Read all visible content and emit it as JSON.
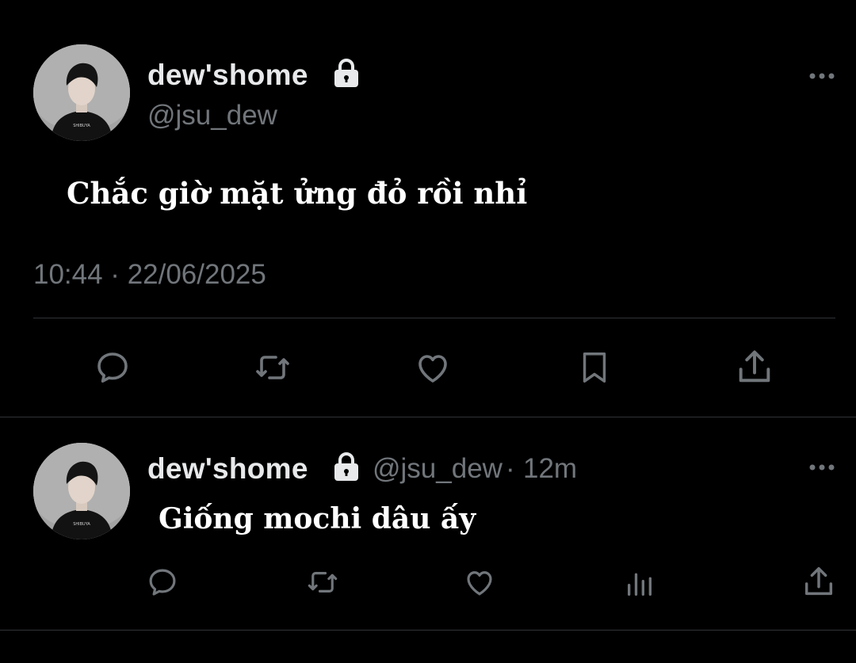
{
  "main_tweet": {
    "display_name": "dew'shome",
    "handle": "@jsu_dew",
    "text": "Chắc giờ mặt ửng đỏ rồi nhỉ",
    "timestamp": "10:44 · 22/06/2025",
    "actions": [
      "reply-icon",
      "retweet-icon",
      "like-icon",
      "bookmark-icon",
      "share-icon"
    ]
  },
  "reply": {
    "display_name": "dew'shome",
    "handle": "@jsu_dew",
    "separator": "·",
    "time": "12m",
    "text": "Giống mochi dâu ấy",
    "actions": [
      "reply-icon",
      "retweet-icon",
      "like-icon",
      "views-icon",
      "share-icon"
    ]
  },
  "colors": {
    "background": "#000000",
    "primary_text": "#e7e9ea",
    "secondary_text": "#71767b",
    "divider": "#2f3336"
  }
}
